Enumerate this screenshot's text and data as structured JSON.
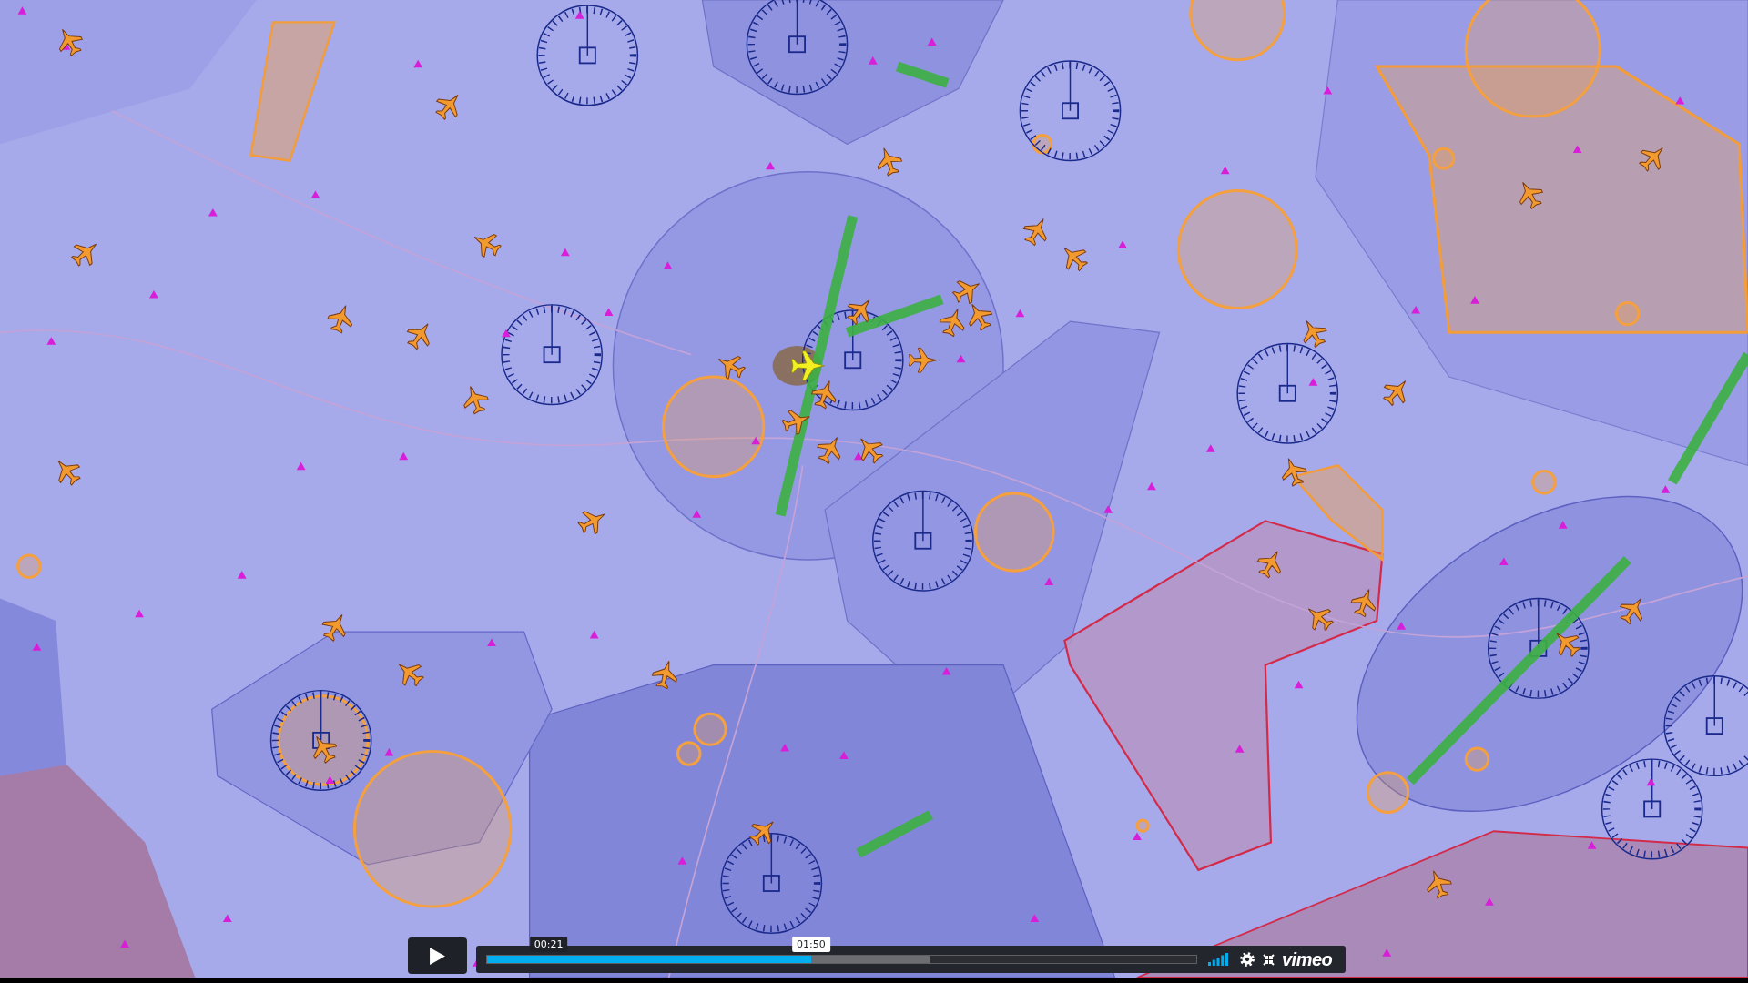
{
  "player": {
    "playing": false,
    "progress": {
      "level": 0.457,
      "current_time": "01:50",
      "buffered": {
        "level": 0.624
      },
      "hover": {
        "time": "00:21",
        "level": 0.088
      }
    },
    "logo": "vimeo"
  }
}
